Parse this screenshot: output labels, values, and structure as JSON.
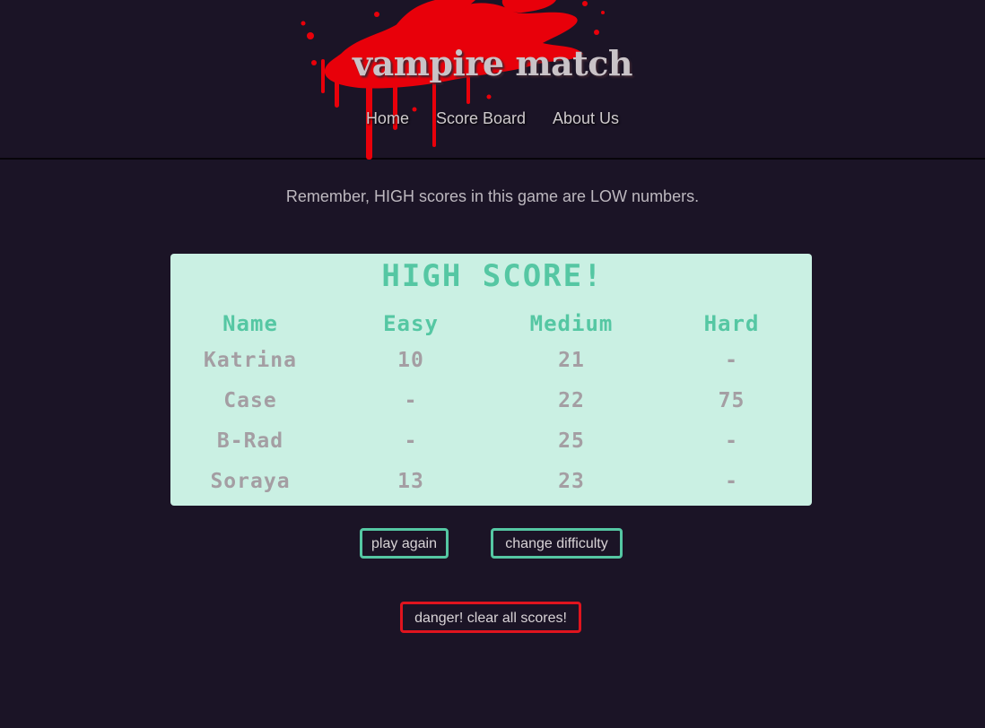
{
  "header": {
    "title": "vampire match",
    "nav": [
      {
        "label": "Home"
      },
      {
        "label": "Score Board"
      },
      {
        "label": "About Us"
      }
    ]
  },
  "notice": "Remember, HIGH scores in this game are LOW numbers.",
  "scoreboard": {
    "title": "HIGH SCORE!",
    "columns": [
      "Name",
      "Easy",
      "Medium",
      "Hard"
    ],
    "rows": [
      [
        "Katrina",
        "10",
        "21",
        "-"
      ],
      [
        "Case",
        "-",
        "22",
        "75"
      ],
      [
        "B-Rad",
        "-",
        "25",
        "-"
      ],
      [
        "Soraya",
        "13",
        "23",
        "-"
      ]
    ]
  },
  "buttons": {
    "play_again": "play again",
    "change_difficulty": "change difficulty",
    "clear_scores": "danger! clear all scores!"
  },
  "colors": {
    "background": "#1b1426",
    "panel": "#caf0e3",
    "accent_teal": "#55c7a3",
    "danger_red": "#e0141e",
    "blood_red": "#e8000a",
    "text": "#bdb8bf"
  },
  "icons": {
    "header_decoration": "blood-splatter"
  }
}
